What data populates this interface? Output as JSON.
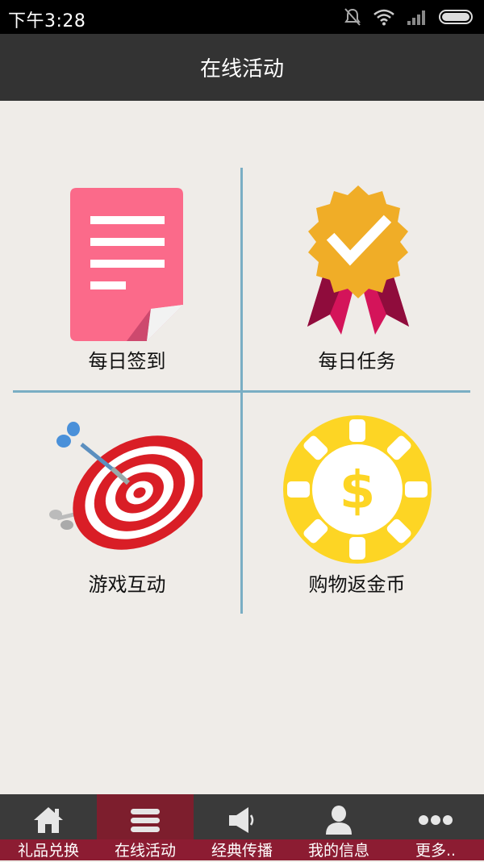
{
  "status_bar": {
    "time": "下午3:28"
  },
  "app_bar": {
    "title": "在线活动"
  },
  "tiles": [
    {
      "label": "每日签到",
      "icon": "document-icon"
    },
    {
      "label": "每日任务",
      "icon": "badge-check-icon"
    },
    {
      "label": "游戏互动",
      "icon": "dartboard-icon"
    },
    {
      "label": "购物返金币",
      "icon": "coin-icon"
    }
  ],
  "tab_bar": {
    "active_index": 1,
    "tabs": [
      {
        "label": "礼品兑换",
        "icon": "home-icon"
      },
      {
        "label": "在线活动",
        "icon": "list-icon"
      },
      {
        "label": "经典传播",
        "icon": "speaker-icon"
      },
      {
        "label": "我的信息",
        "icon": "person-icon"
      },
      {
        "label": "更多..",
        "icon": "more-icon"
      }
    ]
  },
  "colors": {
    "accent_active_tab": "#7d1e2d",
    "tab_label_bg": "#8c1c32",
    "divider": "#7aaec4",
    "app_bar_bg": "#333333",
    "page_bg": "#efece8"
  }
}
